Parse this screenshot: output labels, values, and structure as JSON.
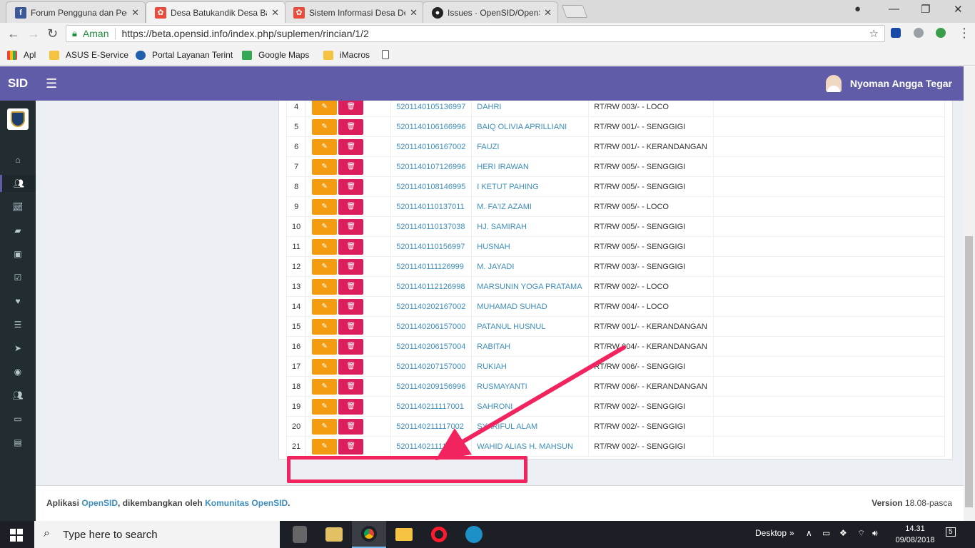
{
  "browser": {
    "tabs": [
      {
        "title": "Forum Pengguna dan Peg",
        "icon": "facebook-icon",
        "active": false
      },
      {
        "title": "Desa Batukandik Desa Ba",
        "icon": "opensid-icon",
        "active": true
      },
      {
        "title": "Sistem Informasi Desa De",
        "icon": "opensid-icon",
        "active": false
      },
      {
        "title": "Issues · OpenSID/OpenSI",
        "icon": "github-icon",
        "active": false
      }
    ],
    "secure_label": "Aman",
    "url": "https://beta.opensid.info/index.php/suplemen/rincian/1/2",
    "bookmarks": [
      "Apl",
      "ASUS E-Service",
      "Portal Layanan Terint",
      "Google Maps",
      "iMacros"
    ]
  },
  "app": {
    "logo": "SID",
    "user_name": "Nyoman Angga Tegar",
    "brand_color": "#605ca8"
  },
  "table": {
    "rows": [
      {
        "no": "4",
        "nik": "5201140105136997",
        "nama": "DAHRI",
        "alamat": "RT/RW 003/- - LOCO"
      },
      {
        "no": "5",
        "nik": "5201140106166996",
        "nama": "BAIQ OLIVIA APRILLIANI",
        "alamat": "RT/RW 001/- - SENGGIGI"
      },
      {
        "no": "6",
        "nik": "5201140106167002",
        "nama": "FAUZI",
        "alamat": "RT/RW 001/- - KERANDANGAN"
      },
      {
        "no": "7",
        "nik": "5201140107126996",
        "nama": "HERI IRAWAN",
        "alamat": "RT/RW 005/- - SENGGIGI"
      },
      {
        "no": "8",
        "nik": "5201140108146995",
        "nama": "I KETUT PAHING",
        "alamat": "RT/RW 005/- - SENGGIGI"
      },
      {
        "no": "9",
        "nik": "5201140110137011",
        "nama": "M. FA'IZ AZAMI",
        "alamat": "RT/RW 005/- - LOCO"
      },
      {
        "no": "10",
        "nik": "5201140110137038",
        "nama": "HJ. SAMIRAH",
        "alamat": "RT/RW 005/- - SENGGIGI"
      },
      {
        "no": "11",
        "nik": "5201140110156997",
        "nama": "HUSNAH",
        "alamat": "RT/RW 005/- - SENGGIGI"
      },
      {
        "no": "12",
        "nik": "5201140111126999",
        "nama": "M. JAYADI",
        "alamat": "RT/RW 003/- - SENGGIGI"
      },
      {
        "no": "13",
        "nik": "5201140112126998",
        "nama": "MARSUNIN YOGA PRATAMA",
        "alamat": "RT/RW 002/- - LOCO"
      },
      {
        "no": "14",
        "nik": "5201140202167002",
        "nama": "MUHAMAD SUHAD",
        "alamat": "RT/RW 004/- - LOCO"
      },
      {
        "no": "15",
        "nik": "5201140206157000",
        "nama": "PATANUL HUSNUL",
        "alamat": "RT/RW 001/- - KERANDANGAN"
      },
      {
        "no": "16",
        "nik": "5201140206157004",
        "nama": "RABITAH",
        "alamat": "RT/RW 004/- - KERANDANGAN"
      },
      {
        "no": "17",
        "nik": "5201140207157000",
        "nama": "RUKIAH",
        "alamat": "RT/RW 006/- - SENGGIGI"
      },
      {
        "no": "18",
        "nik": "5201140209156996",
        "nama": "RUSMAYANTI",
        "alamat": "RT/RW 006/- - KERANDANGAN"
      },
      {
        "no": "19",
        "nik": "5201140211117001",
        "nama": "SAHRONI",
        "alamat": "RT/RW 002/- - SENGGIGI"
      },
      {
        "no": "20",
        "nik": "5201140211117002",
        "nama": "SYARIFUL ALAM",
        "alamat": "RT/RW 002/- - SENGGIGI"
      },
      {
        "no": "21",
        "nik": "5201140211117003",
        "nama": "WAHID ALIAS H. MAHSUN",
        "alamat": "RT/RW 002/- - SENGGIGI"
      }
    ],
    "edit_icon": "edit-icon",
    "delete_icon": "trash-icon"
  },
  "footer": {
    "prefix": "Aplikasi",
    "app_link": "OpenSID",
    "middle": ", dikembangkan oleh",
    "community_link": "Komunitas OpenSID",
    "suffix": ".",
    "version_label": "Version",
    "version": "18.08-pasca"
  },
  "taskbar": {
    "search_placeholder": "Type here to search",
    "desktop_label": "Desktop",
    "time": "14.31",
    "date": "09/08/2018",
    "notifications": "5"
  },
  "annotation": {
    "color": "#f2245f"
  }
}
